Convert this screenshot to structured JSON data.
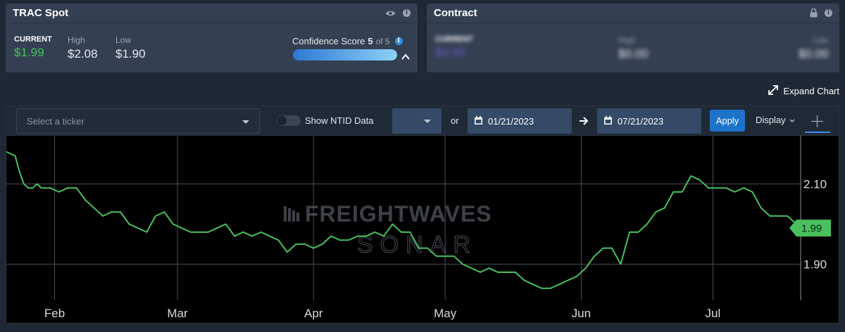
{
  "spot": {
    "title": "TRAC Spot",
    "current_label": "CURRENT",
    "current_value": "$1.99",
    "high_label": "High",
    "high_value": "$2.08",
    "low_label": "Low",
    "low_value": "$1.90",
    "confidence_label": "Confidence Score",
    "confidence_score": "5",
    "confidence_of": "of 5",
    "confidence_fraction": 1.0
  },
  "contract": {
    "title": "Contract",
    "current_label": "CURRENT",
    "current_value": "$0.00",
    "high_label": "High",
    "high_value": "$0.00",
    "low_label": "Low",
    "low_value": "$0.00"
  },
  "expand_label": "Expand Chart",
  "toolbar": {
    "ticker_placeholder": "Select a ticker",
    "ntid_label": "Show NTID Data",
    "or_label": "or",
    "start_date": "01/21/2023",
    "end_date": "07/21/2023",
    "apply_label": "Apply",
    "display_label": "Display"
  },
  "watermark": {
    "line1": "FREIGHTWAVES",
    "line2": "SONAR"
  },
  "colors": {
    "line": "#49c05d",
    "current_marker": "#49c05d",
    "accent": "#1e73c9"
  },
  "chart_data": {
    "type": "line",
    "x_range": [
      "2023-01-21",
      "2023-07-21"
    ],
    "x_tick_labels": [
      "Feb",
      "Mar",
      "Apr",
      "May",
      "Jun",
      "Jul"
    ],
    "x_tick_dates": [
      "2023-02-01",
      "2023-03-01",
      "2023-04-01",
      "2023-05-01",
      "2023-06-01",
      "2023-07-01"
    ],
    "y_ticks": [
      "2.10",
      "1.90"
    ],
    "y_tick_values": [
      2.1,
      1.9
    ],
    "ylim": [
      1.81,
      2.22
    ],
    "current_label": "1.99",
    "current_value": 1.99,
    "grid": true,
    "series": [
      {
        "color": "#49c05d",
        "points": [
          [
            "2023-01-21",
            2.18
          ],
          [
            "2023-01-23",
            2.17
          ],
          [
            "2023-01-24",
            2.13
          ],
          [
            "2023-01-25",
            2.1
          ],
          [
            "2023-01-26",
            2.09
          ],
          [
            "2023-01-27",
            2.09
          ],
          [
            "2023-01-28",
            2.1
          ],
          [
            "2023-01-29",
            2.09
          ],
          [
            "2023-01-31",
            2.09
          ],
          [
            "2023-02-02",
            2.08
          ],
          [
            "2023-02-04",
            2.09
          ],
          [
            "2023-02-06",
            2.09
          ],
          [
            "2023-02-08",
            2.06
          ],
          [
            "2023-02-10",
            2.04
          ],
          [
            "2023-02-12",
            2.02
          ],
          [
            "2023-02-14",
            2.03
          ],
          [
            "2023-02-16",
            2.03
          ],
          [
            "2023-02-18",
            2.0
          ],
          [
            "2023-02-20",
            1.99
          ],
          [
            "2023-02-22",
            1.98
          ],
          [
            "2023-02-24",
            2.02
          ],
          [
            "2023-02-26",
            2.03
          ],
          [
            "2023-02-28",
            2.0
          ],
          [
            "2023-03-02",
            1.99
          ],
          [
            "2023-03-04",
            1.98
          ],
          [
            "2023-03-06",
            1.98
          ],
          [
            "2023-03-08",
            1.98
          ],
          [
            "2023-03-10",
            1.99
          ],
          [
            "2023-03-12",
            2.0
          ],
          [
            "2023-03-14",
            1.97
          ],
          [
            "2023-03-16",
            1.98
          ],
          [
            "2023-03-18",
            1.97
          ],
          [
            "2023-03-20",
            1.98
          ],
          [
            "2023-03-22",
            1.97
          ],
          [
            "2023-03-24",
            1.96
          ],
          [
            "2023-03-26",
            1.93
          ],
          [
            "2023-03-28",
            1.95
          ],
          [
            "2023-03-30",
            1.95
          ],
          [
            "2023-04-01",
            1.94
          ],
          [
            "2023-04-03",
            1.95
          ],
          [
            "2023-04-05",
            1.97
          ],
          [
            "2023-04-07",
            1.96
          ],
          [
            "2023-04-09",
            1.96
          ],
          [
            "2023-04-11",
            1.97
          ],
          [
            "2023-04-13",
            1.97
          ],
          [
            "2023-04-15",
            1.98
          ],
          [
            "2023-04-17",
            1.97
          ],
          [
            "2023-04-19",
            2.0
          ],
          [
            "2023-04-21",
            1.98
          ],
          [
            "2023-04-23",
            1.98
          ],
          [
            "2023-04-25",
            1.94
          ],
          [
            "2023-04-27",
            1.94
          ],
          [
            "2023-04-29",
            1.92
          ],
          [
            "2023-05-01",
            1.92
          ],
          [
            "2023-05-03",
            1.92
          ],
          [
            "2023-05-05",
            1.9
          ],
          [
            "2023-05-07",
            1.89
          ],
          [
            "2023-05-09",
            1.88
          ],
          [
            "2023-05-11",
            1.89
          ],
          [
            "2023-05-13",
            1.88
          ],
          [
            "2023-05-15",
            1.88
          ],
          [
            "2023-05-17",
            1.88
          ],
          [
            "2023-05-19",
            1.86
          ],
          [
            "2023-05-21",
            1.85
          ],
          [
            "2023-05-23",
            1.84
          ],
          [
            "2023-05-25",
            1.84
          ],
          [
            "2023-05-27",
            1.85
          ],
          [
            "2023-05-29",
            1.86
          ],
          [
            "2023-05-31",
            1.87
          ],
          [
            "2023-06-02",
            1.89
          ],
          [
            "2023-06-04",
            1.92
          ],
          [
            "2023-06-06",
            1.94
          ],
          [
            "2023-06-08",
            1.94
          ],
          [
            "2023-06-10",
            1.9
          ],
          [
            "2023-06-12",
            1.98
          ],
          [
            "2023-06-14",
            1.98
          ],
          [
            "2023-06-16",
            2.0
          ],
          [
            "2023-06-18",
            2.03
          ],
          [
            "2023-06-20",
            2.04
          ],
          [
            "2023-06-22",
            2.08
          ],
          [
            "2023-06-24",
            2.08
          ],
          [
            "2023-06-26",
            2.12
          ],
          [
            "2023-06-28",
            2.11
          ],
          [
            "2023-06-30",
            2.09
          ],
          [
            "2023-07-02",
            2.09
          ],
          [
            "2023-07-04",
            2.09
          ],
          [
            "2023-07-06",
            2.08
          ],
          [
            "2023-07-08",
            2.09
          ],
          [
            "2023-07-10",
            2.08
          ],
          [
            "2023-07-12",
            2.04
          ],
          [
            "2023-07-14",
            2.02
          ],
          [
            "2023-07-16",
            2.02
          ],
          [
            "2023-07-18",
            2.02
          ],
          [
            "2023-07-19",
            2.01
          ],
          [
            "2023-07-21",
            1.99
          ]
        ]
      }
    ]
  }
}
